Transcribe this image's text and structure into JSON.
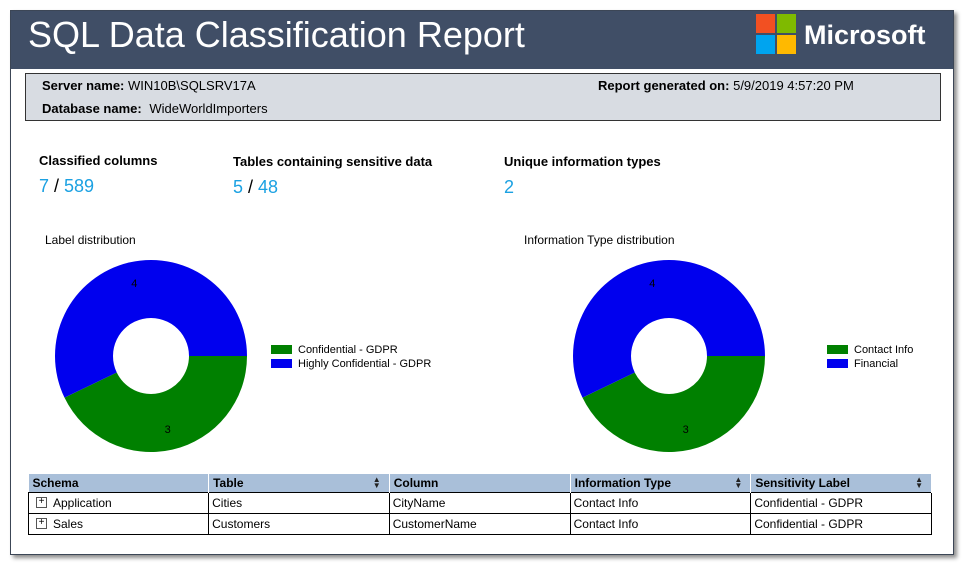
{
  "header": {
    "title": "SQL Data Classification Report",
    "brand": "Microsoft",
    "logo_colors": [
      "#f25022",
      "#7fba00",
      "#00a4ef",
      "#ffb900"
    ]
  },
  "info": {
    "server_label": "Server name:",
    "server_value": "WIN10B\\SQLSRV17A",
    "database_label": "Database name:",
    "database_value": "WideWorldImporters",
    "generated_label": "Report generated on:",
    "generated_value": "5/9/2019 4:57:20 PM"
  },
  "stats": [
    {
      "label": "Classified columns",
      "value": "7",
      "sep": " / ",
      "total": "589"
    },
    {
      "label": "Tables containing sensitive data",
      "value": "5",
      "sep": " / ",
      "total": "48"
    },
    {
      "label": "Unique information types",
      "value": "2"
    }
  ],
  "chart_data": [
    {
      "type": "pie",
      "title": "Label distribution",
      "categories": [
        "Confidential - GDPR",
        "Highly Confidential - GDPR"
      ],
      "values": [
        3,
        4
      ],
      "colors": [
        "#008000",
        "#0000ee"
      ]
    },
    {
      "type": "pie",
      "title": "Information Type distribution",
      "categories": [
        "Contact Info",
        "Financial"
      ],
      "values": [
        3,
        4
      ],
      "colors": [
        "#008000",
        "#0000ee"
      ]
    }
  ],
  "table": {
    "columns": [
      "Schema",
      "Table",
      "Column",
      "Information Type",
      "Sensitivity Label"
    ],
    "rows": [
      [
        "Application",
        "Cities",
        "CityName",
        "Contact Info",
        "Confidential - GDPR"
      ],
      [
        "Sales",
        "Customers",
        "CustomerName",
        "Contact Info",
        "Confidential - GDPR"
      ]
    ]
  }
}
